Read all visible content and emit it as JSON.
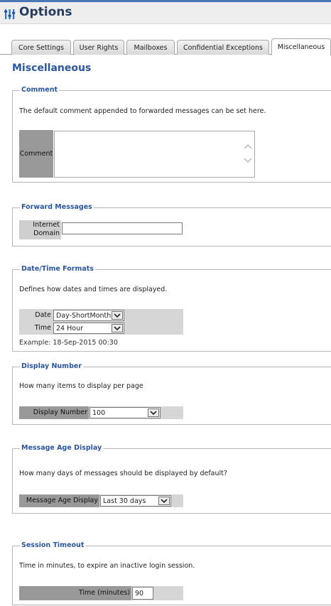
{
  "header": {
    "title": "Options"
  },
  "tabs": [
    {
      "label": "Core Settings"
    },
    {
      "label": "User Rights"
    },
    {
      "label": "Mailboxes"
    },
    {
      "label": "Confidential Exceptions"
    },
    {
      "label": "Miscellaneous"
    }
  ],
  "page": {
    "title": "Miscellaneous"
  },
  "comment": {
    "legend": "Comment",
    "description": "The default comment appended to forwarded messages can be set here.",
    "label": "Comment",
    "value": ""
  },
  "forward": {
    "legend": "Forward Messages",
    "label_line1": "Internet",
    "label_line2": "Domain",
    "value": ""
  },
  "datetime": {
    "legend": "Date/Time Formats",
    "description": "Defines how dates and times are displayed.",
    "date_label": "Date",
    "date_value": "Day-ShortMonth",
    "time_label": "Time",
    "time_value": "24 Hour",
    "example": "Example: 18-Sep-2015 00:30"
  },
  "display": {
    "legend": "Display Number",
    "description": "How many items to display per page",
    "label": "Display Number",
    "value": "100"
  },
  "age": {
    "legend": "Message Age Display",
    "description": "How many days of messages should be displayed by default?",
    "label": "Message Age Display",
    "value": "Last 30 days"
  },
  "session": {
    "legend": "Session Timeout",
    "description": "Time in minutes, to expire an inactive login session.",
    "label": "Time (minutes)",
    "value": "90"
  }
}
